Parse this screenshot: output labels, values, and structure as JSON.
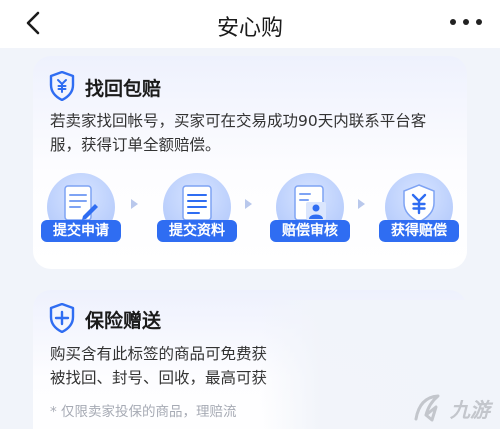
{
  "header": {
    "title": "安心购"
  },
  "card_recover": {
    "title": "找回包赔",
    "description": "若卖家找回帐号，买家可在交易成功90天内联系平台客服，获得订单全额赔偿。",
    "steps": [
      {
        "label": "提交申请",
        "icon": "document-edit-icon"
      },
      {
        "label": "提交资料",
        "icon": "document-list-icon"
      },
      {
        "label": "赔偿审核",
        "icon": "profile-review-icon"
      },
      {
        "label": "获得赔偿",
        "icon": "yuan-shield-icon"
      }
    ]
  },
  "card_insurance": {
    "title": "保险赠送",
    "line1": "购买含有此标签的商品可免费获",
    "line2": "被找回、封号、回收，最高可获",
    "note": "* 仅限卖家投保的商品，理赔流"
  },
  "watermark": {
    "text": "九游"
  },
  "colors": {
    "accent": "#2f6df2",
    "background": "#f1f4fa"
  }
}
